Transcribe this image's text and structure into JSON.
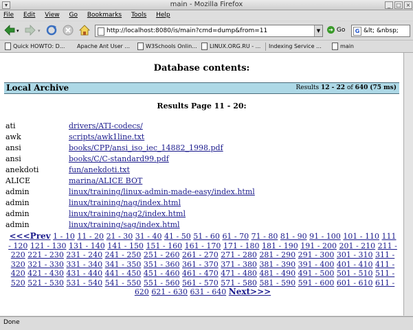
{
  "window": {
    "title": "main - Mozilla Firefox"
  },
  "menu": [
    "File",
    "Edit",
    "View",
    "Go",
    "Bookmarks",
    "Tools",
    "Help"
  ],
  "toolbar": {
    "url": "http://localhost:8080/is/main?cmd=dump&from=11",
    "go_label": "Go",
    "search_value": "&lt; &nbsp;"
  },
  "bookmarks": [
    "Quick HOWTO: D...",
    "Apache Ant User ...",
    "W3Schools Onlin...",
    "LINUX.ORG.RU - ...",
    "Indexing Service ...",
    "main"
  ],
  "page": {
    "heading": "Database contents:",
    "archive_name": "Local Archive",
    "results_prefix": "Results",
    "results_range": "12 - 22",
    "results_of": "of",
    "results_total": "640",
    "results_time": "(75 ms)",
    "results_page": "Results Page 11 - 20:"
  },
  "rows": [
    {
      "key": "ati",
      "link": "drivers/ATI-codecs/"
    },
    {
      "key": "awk",
      "link": "scripts/awk1line.txt"
    },
    {
      "key": "ansi",
      "link": "books/CPP/ansi_iso_iec_14882_1998.pdf"
    },
    {
      "key": "ansi",
      "link": "books/C/C-standard99.pdf"
    },
    {
      "key": "anekdoti",
      "link": "fun/anekdoti.txt"
    },
    {
      "key": "ALICE",
      "link": "marina/ALICE BOT"
    },
    {
      "key": "admin",
      "link": "linux/training/linux-admin-made-easy/index.html"
    },
    {
      "key": "admin",
      "link": "linux/training/nag/index.html"
    },
    {
      "key": "admin",
      "link": "linux/training/nag2/index.html"
    },
    {
      "key": "admin",
      "link": "linux/training/sag/index.html"
    }
  ],
  "pager": {
    "prev": "<<<Prev",
    "next": "Next>>>",
    "ranges": [
      "1 - 10",
      "11 - 20",
      "21 - 30",
      "31 - 40",
      "41 - 50",
      "51 - 60",
      "61 - 70",
      "71 - 80",
      "81 - 90",
      "91 - 100",
      "101 - 110",
      "111 - 120",
      "121 - 130",
      "131 - 140",
      "141 - 150",
      "151 - 160",
      "161 - 170",
      "171 - 180",
      "181 - 190",
      "191 - 200",
      "201 - 210",
      "211 - 220",
      "221 - 230",
      "231 - 240",
      "241 - 250",
      "251 - 260",
      "261 - 270",
      "271 - 280",
      "281 - 290",
      "291 - 300",
      "301 - 310",
      "311 - 320",
      "321 - 330",
      "331 - 340",
      "341 - 350",
      "351 - 360",
      "361 - 370",
      "371 - 380",
      "381 - 390",
      "391 - 400",
      "401 - 410",
      "411 - 420",
      "421 - 430",
      "431 - 440",
      "441 - 450",
      "451 - 460",
      "461 - 470",
      "471 - 480",
      "481 - 490",
      "491 - 500",
      "501 - 510",
      "511 - 520",
      "521 - 530",
      "531 - 540",
      "541 - 550",
      "551 - 560",
      "561 - 570",
      "571 - 580",
      "581 - 590",
      "591 - 600",
      "601 - 610",
      "611 - 620",
      "621 - 630",
      "631 - 640"
    ]
  },
  "status": "Done",
  "colors": {
    "archive_bar": "#add8e6",
    "link": "#1a1a8c"
  }
}
